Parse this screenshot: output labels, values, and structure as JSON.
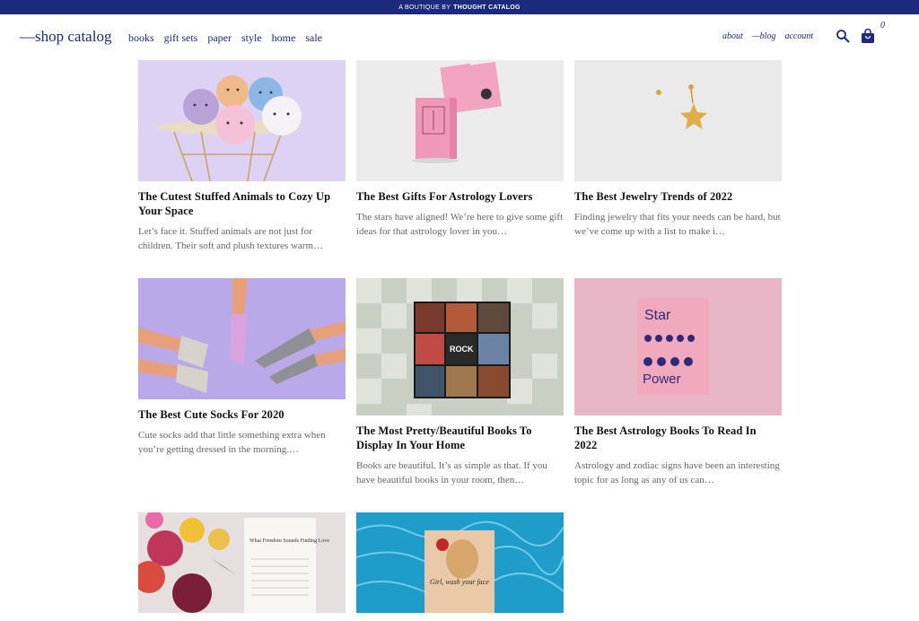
{
  "topbar": {
    "prefix": "A BOUTIQUE BY",
    "brand": "THOUGHT CATALOG"
  },
  "header": {
    "logo": "—shop catalog",
    "nav": [
      "books",
      "gift sets",
      "paper",
      "style",
      "home",
      "sale"
    ],
    "subnav": [
      "about",
      "—blog",
      "account"
    ],
    "cart_count": "0"
  },
  "posts": [
    {
      "title": "The Cutest Stuffed Animals to Cozy Up Your Space",
      "excerpt": "Let’s face it. Stuffed animals are not just for children. Their soft and plush textures warm…"
    },
    {
      "title": "The Best Gifts For Astrology Lovers",
      "excerpt": "The stars have aligned! We’re here to give some gift ideas for that astrology lover in you…"
    },
    {
      "title": "The Best Jewelry Trends of 2022",
      "excerpt": "Finding jewelry that fits your needs can be hard, but we’ve come up with a list to make i…"
    },
    {
      "title": "The Best Cute Socks For 2020",
      "excerpt": "Cute socks add that little something extra when you’re getting dressed in the morning.…"
    },
    {
      "title": "The Most Pretty/Beautiful Books To Display In Your Home",
      "excerpt": "Books are beautiful. It’s as simple as that. If you have beautiful books in your room, then…"
    },
    {
      "title": "The Best Astrology Books To Read In 2022",
      "excerpt": "Astrology and zodiac signs have been an interesting topic for as long as any of us can…"
    },
    {
      "title": "",
      "excerpt": ""
    },
    {
      "title": "",
      "excerpt": ""
    }
  ],
  "images": {
    "star_power_cover": [
      "Star",
      "Power"
    ],
    "rock_cover": "ROCK",
    "girl_wash_cover": "Girl, wash your face",
    "flowers_page_heading": "What Freedom Sounds Finding Love"
  },
  "colors": {
    "brand": "#1b2a7a",
    "title": "#111111",
    "excerpt": "#666666"
  }
}
